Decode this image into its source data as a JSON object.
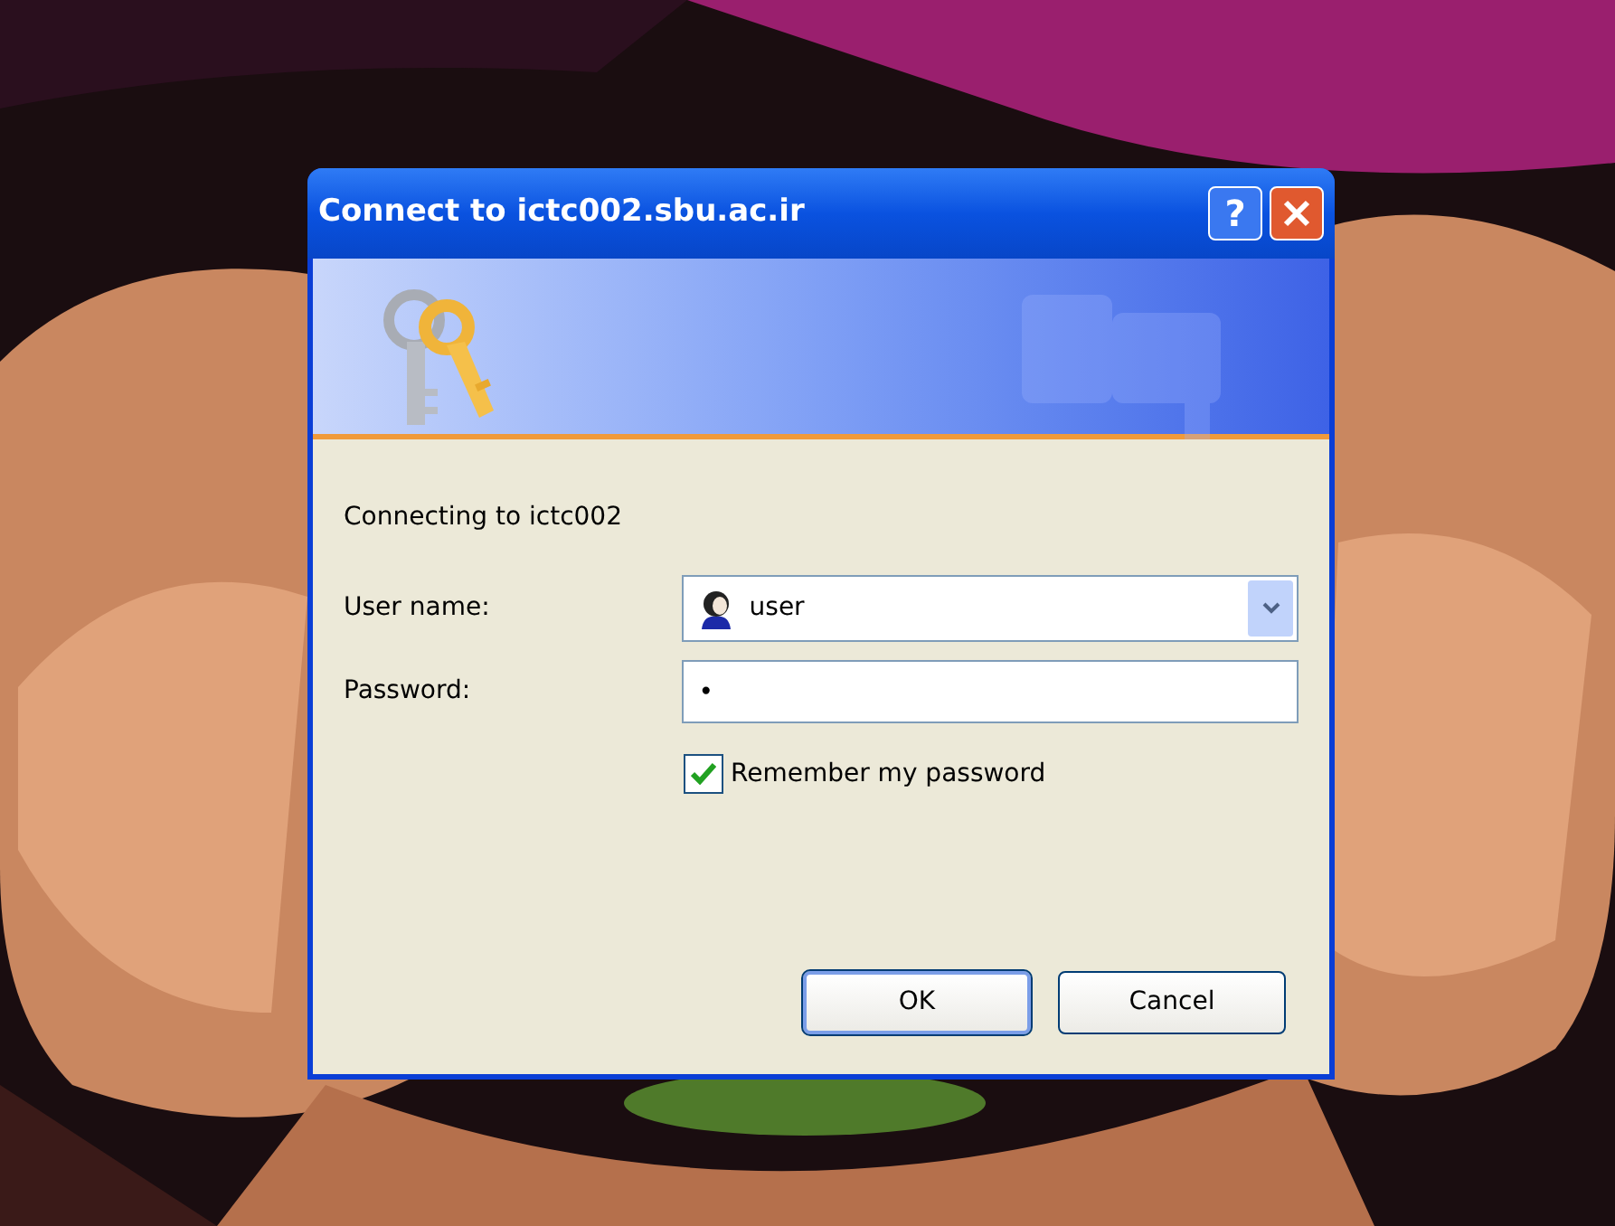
{
  "dialog": {
    "title": "Connect to ictc002.sbu.ac.ir",
    "title_buttons": [
      {
        "kind": "help",
        "label": "?"
      },
      {
        "kind": "close"
      }
    ],
    "message": "Connecting to ictc002",
    "fields": [
      {
        "kind": "combo",
        "label": "User name:",
        "value": "user"
      },
      {
        "kind": "password",
        "label": "Password:",
        "value": "•"
      }
    ],
    "checkbox": {
      "label": "Remember my password",
      "checked": true
    },
    "buttons": [
      {
        "label": "OK",
        "default": true
      },
      {
        "label": "Cancel",
        "default": false
      }
    ]
  }
}
